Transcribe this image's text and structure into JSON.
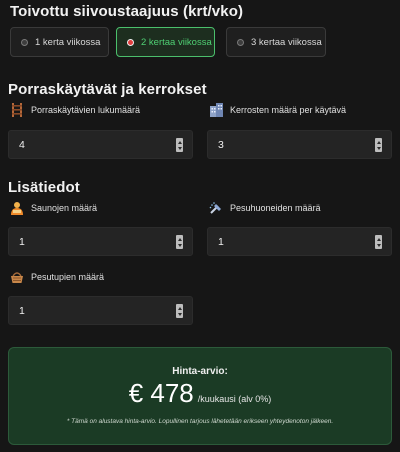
{
  "frequency": {
    "title": "Toivottu siivoustaajuus (krt/vko)",
    "options": [
      {
        "label": "1 kerta viikossa",
        "selected": false
      },
      {
        "label": "2 kertaa viikossa",
        "selected": true
      },
      {
        "label": "3 kertaa viikossa",
        "selected": false
      }
    ]
  },
  "stairs": {
    "title": "Porraskäytävät ja kerrokset",
    "stair_count": {
      "label": "Porraskäytävien lukumäärä",
      "value": "4",
      "icon": "ladder-icon"
    },
    "floors_per_stair": {
      "label": "Kerrosten määrä per käytävä",
      "value": "3",
      "icon": "building-icon"
    }
  },
  "extras": {
    "title": "Lisätiedot",
    "saunas": {
      "label": "Saunojen määrä",
      "value": "1",
      "icon": "sauna-icon"
    },
    "bathrooms": {
      "label": "Pesuhuoneiden määrä",
      "value": "1",
      "icon": "shower-icon"
    },
    "laundry_rooms": {
      "label": "Pesutupien määrä",
      "value": "1",
      "icon": "laundry-basket-icon"
    }
  },
  "price": {
    "title": "Hinta-arvio:",
    "amount": "€ 478",
    "suffix": "/kuukausi (alv 0%)",
    "note": "* Tämä on alustava hinta-arvio. Lopullinen tarjous lähetetään erikseen yhteydenoton jälkeen."
  },
  "colors": {
    "background": "#161616",
    "accent_green": "#4bbf6c",
    "price_box_bg": "#1b3b25",
    "selected_radio": "#e23d3d"
  }
}
